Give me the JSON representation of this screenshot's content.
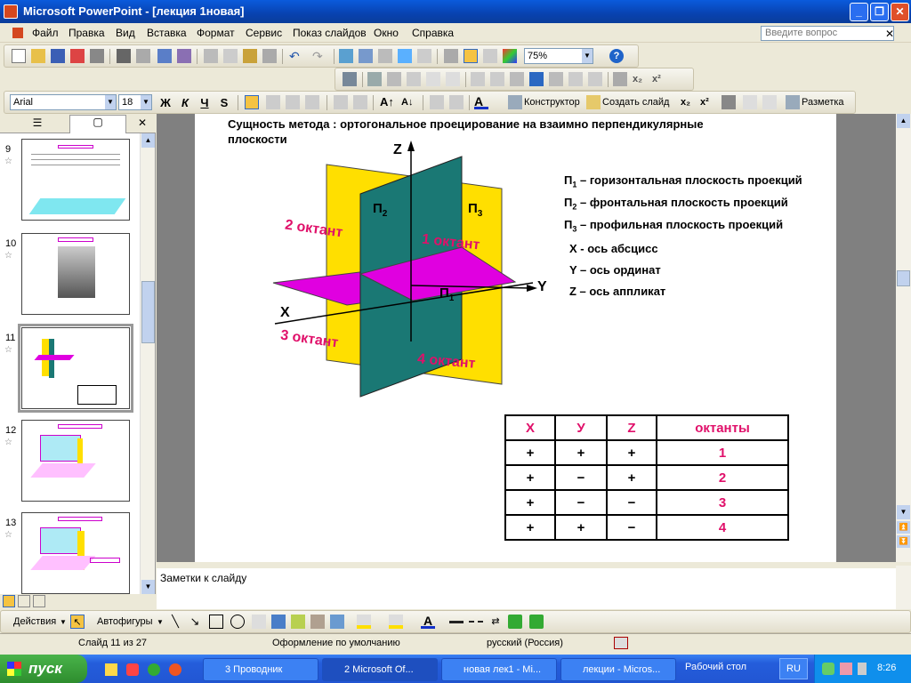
{
  "window": {
    "title": "Microsoft PowerPoint - [лекция 1новая]"
  },
  "menu": {
    "items": [
      "Файл",
      "Правка",
      "Вид",
      "Вставка",
      "Формат",
      "Сервис",
      "Показ слайдов",
      "Окно",
      "Справка"
    ],
    "help_placeholder": "Введите вопрос"
  },
  "toolbar": {
    "zoom": "75%",
    "font_name": "Arial",
    "font_size": "18",
    "bold": "Ж",
    "italic": "К",
    "underline": "Ч",
    "shadow": "S",
    "designer": "Конструктор",
    "new_slide": "Создать слайд",
    "layout": "Разметка"
  },
  "thumbnails": [
    {
      "num": "9"
    },
    {
      "num": "10"
    },
    {
      "num": "11"
    },
    {
      "num": "12"
    },
    {
      "num": "13"
    }
  ],
  "slide": {
    "heading_line1": "Сущность метода : ортогональное проецирование на взаимно перпендикулярные",
    "heading_line2": "плоскости",
    "axis_z": "Z",
    "axis_y": "Y",
    "axis_x": "X",
    "pi2": "П",
    "pi2_sub": "2",
    "pi3": "П",
    "pi3_sub": "3",
    "pi1": "П",
    "pi1_sub": "1",
    "octant1": "1 октант",
    "octant2": "2 октант",
    "octant3": "3 октант",
    "octant4": "4 октант",
    "legend": [
      {
        "p": "П",
        "sub": "1",
        "text": " – горизонтальная плоскость проекций"
      },
      {
        "p": "П",
        "sub": "2",
        "text": " – фронтальная плоскость проекций"
      },
      {
        "p": "П",
        "sub": "3",
        "text": " – профильная  плоскость проекций"
      }
    ],
    "axis_desc": [
      "X  -  ось  абсцисс",
      "Y – ось  ординат",
      "Z – ось аппликат"
    ],
    "table": {
      "headers": [
        "X",
        "У",
        "Z",
        "октанты"
      ],
      "rows": [
        [
          "+",
          "+",
          "+",
          "1"
        ],
        [
          "+",
          "−",
          "+",
          "2"
        ],
        [
          "+",
          "−",
          "−",
          "3"
        ],
        [
          "+",
          "+",
          "−",
          "4"
        ]
      ]
    }
  },
  "notes": {
    "placeholder": "Заметки к слайду"
  },
  "drawing": {
    "actions": "Действия",
    "autoshapes": "Автофигуры"
  },
  "status": {
    "slide": "Слайд 11 из 27",
    "design": "Оформление по умолчанию",
    "language": "русский (Россия)"
  },
  "taskbar": {
    "start": "пуск",
    "tasks": [
      "3 Проводник",
      "2 Microsoft Of...",
      "новая лек1 - Mi...",
      "лекции - Micros...",
      "Рабочий стол"
    ],
    "lang": "RU",
    "clock": "8:26"
  },
  "colors": {
    "yellow": "#ffdf00",
    "teal": "#1a7874",
    "magenta": "#e000e0",
    "pink_text": "#e0106a"
  }
}
